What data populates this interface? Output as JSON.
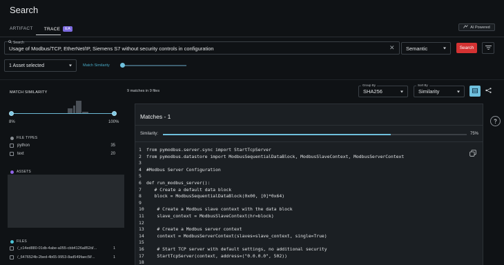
{
  "page": {
    "title": "Search"
  },
  "tabs": [
    {
      "label": "ARTIFACT"
    },
    {
      "label": "TRACE",
      "badge": "EA"
    }
  ],
  "ai_button": {
    "label": "AI Powered"
  },
  "search": {
    "label": "Search",
    "value": "Usage of Modbus/TCP, EtherNet/IP, Siemens S7 without security controls in configuration",
    "mode": "Semantic",
    "button": "Search"
  },
  "asset_select": {
    "value": "1 Asset selected"
  },
  "match_similarity_top": {
    "label": "Match Similarity"
  },
  "sidebar": {
    "match_similarity_title": "MATCH SIMILARITY",
    "range_min": "8%",
    "range_max": "100%",
    "file_types": {
      "title": "FILE TYPES",
      "color": "#8a8f94",
      "items": [
        {
          "label": "python",
          "count": "35"
        },
        {
          "label": "text",
          "count": "20"
        }
      ]
    },
    "assets": {
      "title": "ASSETS",
      "color": "#8f63e6"
    },
    "files": {
      "title": "FILES",
      "color": "#4cc3d6",
      "items": [
        {
          "label": "/_c14ed880-01db-4abe-a055-cbb4126a852d/...",
          "count": "1"
        },
        {
          "label": "/_6476524b-2bed-4b65-9953-8ad549faec5f/...",
          "count": "1"
        }
      ]
    }
  },
  "results": {
    "summary": "9 matches in 9 files",
    "group_by": {
      "label": "Group By",
      "value": "SHA256"
    },
    "sort_by": {
      "label": "Sort By",
      "value": "Similarity"
    }
  },
  "match_panel": {
    "title": "Matches - 1",
    "similarity_label": "Similarity:",
    "similarity_value": 75,
    "similarity_text": "75%",
    "code_lines": [
      {
        "n": "1",
        "text": "from pymodbus.server.sync import StartTcpServer"
      },
      {
        "n": "2",
        "text": "from pymodbus.datastore import ModbusSequentialDataBlock, ModbusSlaveContext, ModbusServerContext"
      },
      {
        "n": "3",
        "text": ""
      },
      {
        "n": "4",
        "text": "#Modbus Server Configuration"
      },
      {
        "n": "5",
        "text": ""
      },
      {
        "n": "6",
        "text": "def run_modbus_server():"
      },
      {
        "n": "7",
        "text": "   # Create a default data block"
      },
      {
        "n": "8",
        "text": "   block = ModbusSequentialDataBlock(0x00, [0]*0x64)"
      },
      {
        "n": "9",
        "text": ""
      },
      {
        "n": "10",
        "text": "    # Create a Modbus slave context with the data block"
      },
      {
        "n": "11",
        "text": "    slave_context = ModbusSlaveContext(hr=block)"
      },
      {
        "n": "12",
        "text": ""
      },
      {
        "n": "13",
        "text": "    # Create a Modbus server context"
      },
      {
        "n": "14",
        "text": "    context = ModbusServerContext(slaves=slave_context, single=True)"
      },
      {
        "n": "15",
        "text": ""
      },
      {
        "n": "16",
        "text": "    # Start TCP server with default settings, no additional security"
      },
      {
        "n": "17",
        "text": "    StartTcpServer(context, address=(\"0.0.0.0\", 502))"
      },
      {
        "n": "18",
        "text": ""
      }
    ]
  },
  "colors": {
    "accent": "#6fc0dd",
    "danger": "#d43232",
    "badge": "#7d6be0"
  },
  "icons": [
    "search-icon",
    "sparkle-icon",
    "close-icon",
    "filter-icon",
    "chevron-down-icon",
    "list-view-icon",
    "graph-view-icon",
    "copy-icon",
    "help-icon"
  ]
}
